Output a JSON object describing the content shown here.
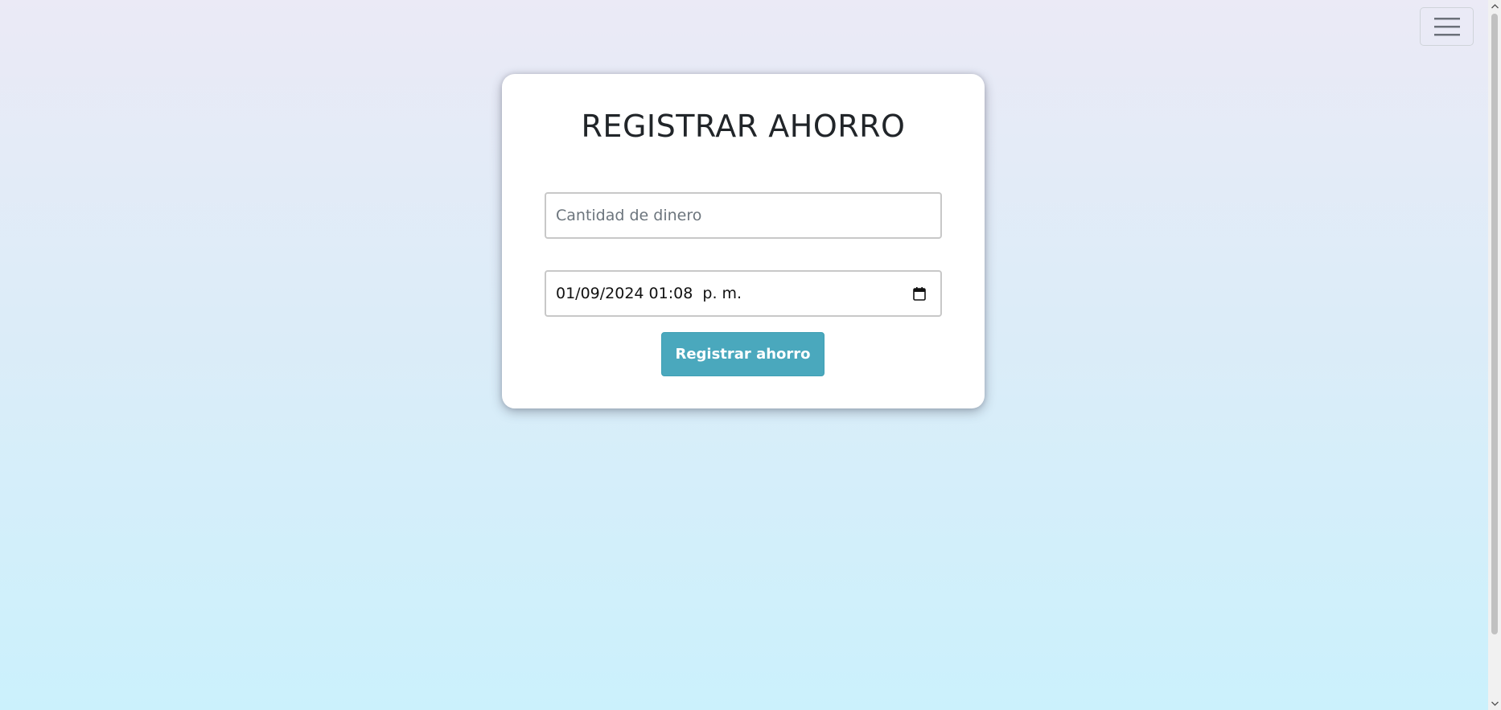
{
  "header": {
    "menu_icon": "hamburger-menu-icon"
  },
  "form": {
    "title": "REGISTRAR AHORRO",
    "amount_placeholder": "Cantidad de dinero",
    "amount_value": "",
    "datetime_value": "01/09/2024 01:08  p. m.",
    "calendar_icon": "calendar-icon",
    "submit_label": "Registrar ahorro"
  },
  "colors": {
    "background_top": "#ebeaf6",
    "background_bottom": "#cbf1fc",
    "button": "#4aa8bd",
    "title_text": "#212529"
  }
}
